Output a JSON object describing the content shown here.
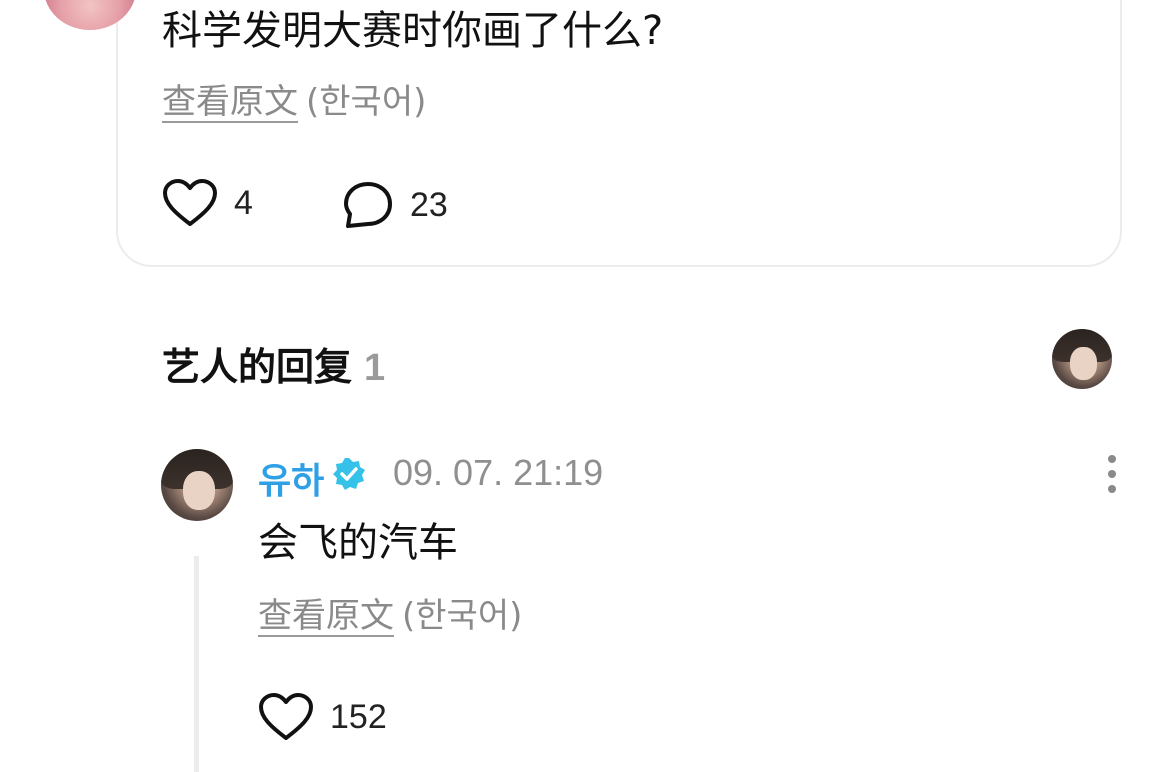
{
  "post": {
    "question": "科学发明大赛时你画了什么?",
    "translate_link": "查看原文",
    "translate_lang": "(한국어)",
    "likes": "4",
    "comments": "23"
  },
  "artist_replies": {
    "title": "艺人的回复",
    "count": "1"
  },
  "reply": {
    "author": "유하",
    "timestamp": "09. 07. 21:19",
    "text": "会飞的汽车",
    "translate_link": "查看原文",
    "translate_lang": "(한국어)",
    "likes": "152"
  },
  "icons": {
    "like": "heart-icon",
    "comment": "comment-bubble-icon",
    "verified": "verified-badge-icon",
    "more": "more-vertical-icon"
  },
  "colors": {
    "accent": "#2f9fe6",
    "verified": "#36c2e8",
    "muted": "#8a8a8a"
  }
}
